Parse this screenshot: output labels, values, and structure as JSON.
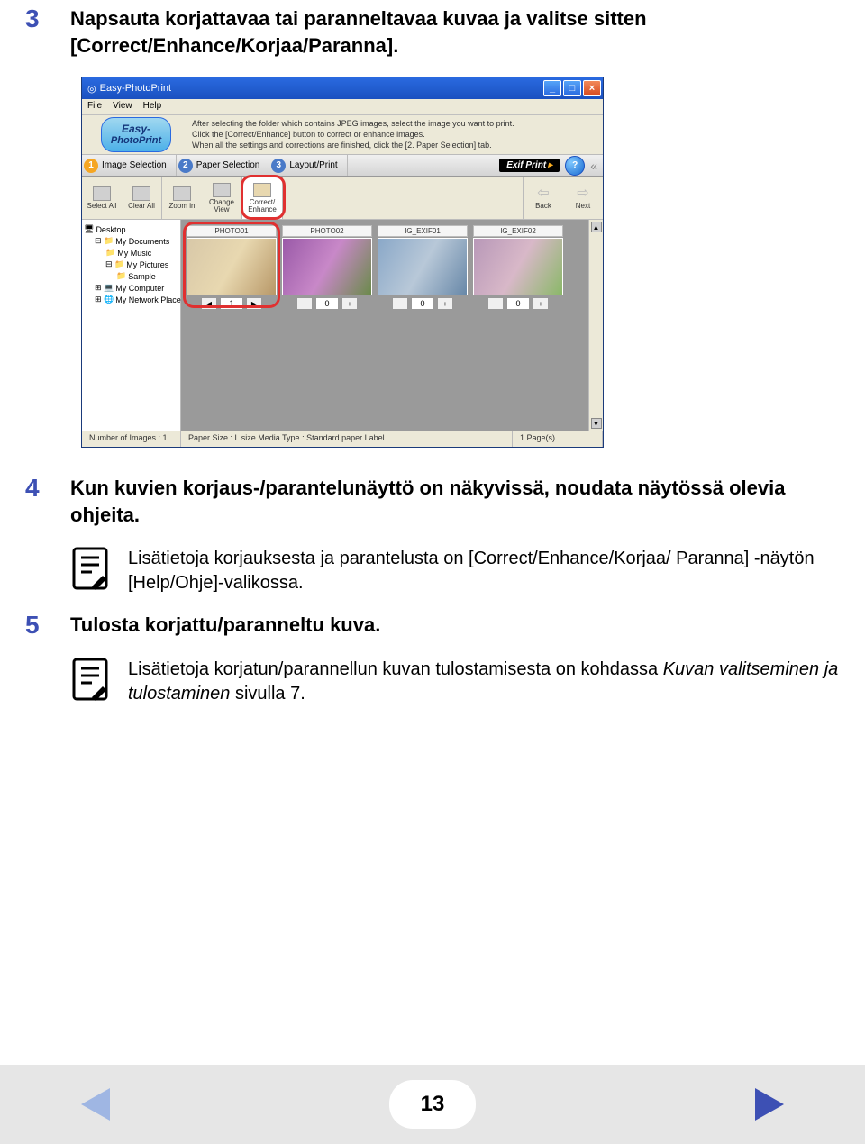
{
  "steps": {
    "s3": {
      "num": "3",
      "text": "Napsauta korjattavaa tai paranneltavaa kuvaa ja valitse sitten [Correct/Enhance/Korjaa/Paranna]."
    },
    "s4": {
      "num": "4",
      "text": "Kun kuvien korjaus-/parantelunäyttö on näkyvissä, noudata näytössä olevia ohjeita."
    },
    "s5": {
      "num": "5",
      "text": "Tulosta korjattu/paranneltu kuva."
    }
  },
  "notes": {
    "n1": "Lisätietoja korjauksesta ja parantelusta on [Correct/Enhance/Korjaa/ Paranna] -näytön [Help/Ohje]-valikossa.",
    "n2a": "Lisätietoja korjatun/parannellun kuvan tulostamisesta on kohdassa ",
    "n2b": "Kuvan valitseminen ja tulostaminen",
    "n2c": " sivulla 7."
  },
  "page_number": "13",
  "app": {
    "title": "Easy-PhotoPrint",
    "menus": [
      "File",
      "View",
      "Help"
    ],
    "logo_top": "Easy-",
    "logo_bot": "PhotoPrint",
    "info": [
      "After selecting the folder which contains JPEG images, select the image you want to print.",
      "Click the [Correct/Enhance] button to correct or enhance images.",
      "When all the settings and corrections are finished, click the [2. Paper Selection] tab."
    ],
    "tabs": [
      {
        "num": "1",
        "label": "Image Selection"
      },
      {
        "num": "2",
        "label": "Paper Selection"
      },
      {
        "num": "3",
        "label": "Layout/Print"
      }
    ],
    "exif": "Exif Print",
    "tools": {
      "select_all": "Select All",
      "clear_all": "Clear All",
      "zoom_in": "Zoom in",
      "change_view": "Change View",
      "correct_enhance_1": "Correct/",
      "correct_enhance_2": "Enhance",
      "back": "Back",
      "next": "Next"
    },
    "tree": {
      "desktop": "Desktop",
      "my_documents": "My Documents",
      "my_music": "My Music",
      "my_pictures": "My Pictures",
      "sample": "Sample",
      "my_computer": "My Computer",
      "my_network": "My Network Places"
    },
    "thumbs": [
      {
        "label": "PHOTO01",
        "count": "1",
        "colors": "#d8c8a8,#e8d8b0,#b89868",
        "selected": true
      },
      {
        "label": "PHOTO02",
        "count": "0",
        "colors": "#9a5aa8,#c888c8,#6a8a4a",
        "selected": false
      },
      {
        "label": "IG_EXIF01",
        "count": "0",
        "colors": "#8aa8c8,#b8c8d8,#6888a8",
        "selected": false
      },
      {
        "label": "IG_EXIF02",
        "count": "0",
        "colors": "#b898b8,#d8b8c8,#8ab868",
        "selected": false
      }
    ],
    "status": {
      "left": "Number of Images : 1",
      "mid": "Paper Size : L size  Media Type : Standard paper Label",
      "right": "1 Page(s)"
    }
  }
}
